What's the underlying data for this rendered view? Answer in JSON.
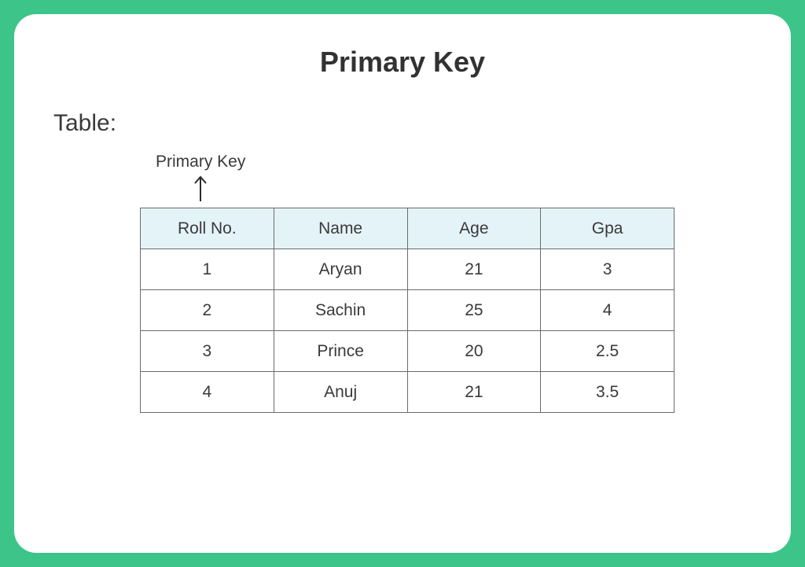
{
  "title": "Primary Key",
  "subtitle": "Table:",
  "annotation": "Primary Key",
  "headers": [
    "Roll No.",
    "Name",
    "Age",
    "Gpa"
  ],
  "rows": [
    {
      "roll": "1",
      "name": "Aryan",
      "age": "21",
      "gpa": "3"
    },
    {
      "roll": "2",
      "name": "Sachin",
      "age": "25",
      "gpa": "4"
    },
    {
      "roll": "3",
      "name": "Prince",
      "age": "20",
      "gpa": "2.5"
    },
    {
      "roll": "4",
      "name": "Anuj",
      "age": "21",
      "gpa": "3.5"
    }
  ]
}
